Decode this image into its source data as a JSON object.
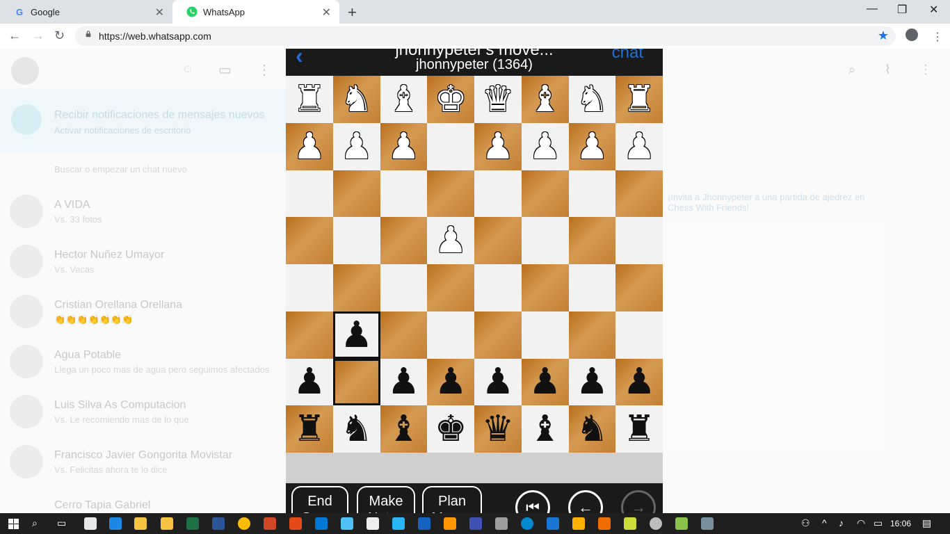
{
  "browser": {
    "tabs": [
      {
        "label": "Google",
        "favicon": "G",
        "active": false
      },
      {
        "label": "WhatsApp",
        "favicon": "whatsapp-icon",
        "active": true
      }
    ],
    "url": "https://web.whatsapp.com"
  },
  "whatsapp_bg": {
    "notification": {
      "line1": "Recibir notificaciones de mensajes nuevos",
      "line2": "Activar notificaciones de escritorio"
    },
    "search_placeholder": "Buscar o empezar un chat nuevo",
    "chats": [
      {
        "name": "A VIDA",
        "preview": "Vs. 33 fotos"
      },
      {
        "name": "Hector Nuñez Umayor",
        "preview": "Vs. Vacas"
      },
      {
        "name": "Cristian Orellana Orellana",
        "preview": "👏👏👏👏👏👏👏"
      },
      {
        "name": "Agua Potable",
        "preview": "Llega un poco mas de agua pero seguimos afectados"
      },
      {
        "name": "Luis Silva As Computacion",
        "preview": "Vs. Le recomiendo mas de lo que"
      },
      {
        "name": "Francisco Javier Gongorita Movistar",
        "preview": "Vs. Felicitas ahora te lo dice"
      },
      {
        "name": "Cerro Tapia Gabriel",
        "preview": ""
      }
    ],
    "right_link": "¡Invita a Jhonnypeter a una partida de ajedrez en Chess With Friends!"
  },
  "chess": {
    "title": "jhonnypeter's move...",
    "subtitle": "jhonnypeter (1364)",
    "chat_label": "chat",
    "board": [
      [
        "wR",
        "wN",
        "wB",
        "wK",
        "wQ",
        "wB",
        "wN",
        "wR"
      ],
      [
        "wP",
        "wP",
        "wP",
        "",
        "wP",
        "wP",
        "wP",
        "wP"
      ],
      [
        "",
        "",
        "",
        "",
        "",
        "",
        "",
        ""
      ],
      [
        "",
        "",
        "",
        "wP",
        "",
        "",
        "",
        ""
      ],
      [
        "",
        "",
        "",
        "",
        "",
        "",
        "",
        ""
      ],
      [
        "",
        "bP",
        "",
        "",
        "",
        "",
        "",
        ""
      ],
      [
        "bP",
        "",
        "bP",
        "bP",
        "bP",
        "bP",
        "bP",
        "bP"
      ],
      [
        "bR",
        "bN",
        "bB",
        "bK",
        "bQ",
        "bB",
        "bN",
        "bR"
      ]
    ],
    "highlight": [
      [
        5,
        1
      ],
      [
        6,
        1
      ]
    ],
    "buttons": {
      "end_game": "End Game",
      "make_notes": "Make Notes",
      "plan_moves": "Plan Moves"
    },
    "colors": {
      "dark_square": "#c27f34",
      "light_square": "#f2f2f2",
      "accent": "#1e6fd9"
    }
  },
  "taskbar": {
    "time": "16:06"
  }
}
